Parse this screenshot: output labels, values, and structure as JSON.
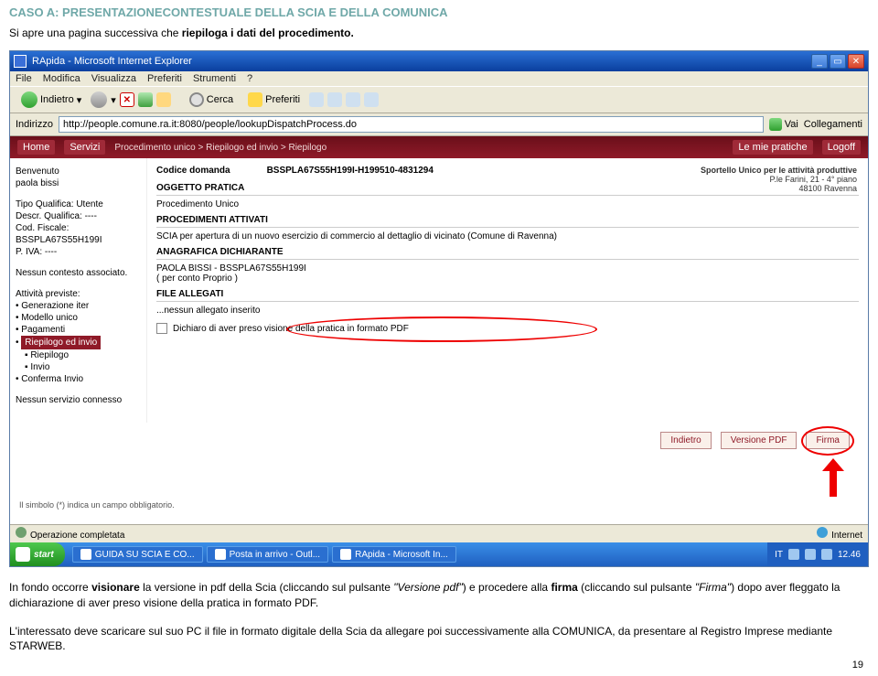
{
  "doc": {
    "title_line1": "CASO A: PRESENTAZIONECONTESTUALE  DELLA SCIA E DELLA COMUNICA",
    "intro_prefix": "Si apre una pagina successiva che ",
    "intro_bold": "riepiloga i dati del procedimento.",
    "page_num": "19"
  },
  "browser": {
    "title": "RApida - Microsoft Internet Explorer",
    "menu": {
      "file": "File",
      "modifica": "Modifica",
      "visualizza": "Visualizza",
      "preferiti": "Preferiti",
      "strumenti": "Strumenti",
      "help": "?"
    },
    "toolbar": {
      "indietro": "Indietro",
      "cerca": "Cerca",
      "preferiti": "Preferiti"
    },
    "address": {
      "label": "Indirizzo",
      "url": "http://people.comune.ra.it:8080/people/lookupDispatchProcess.do",
      "go": "Vai",
      "links": "Collegamenti"
    },
    "status": {
      "left": "Operazione completata",
      "right": "Internet"
    }
  },
  "app": {
    "nav": {
      "home": "Home",
      "servizi": "Servizi",
      "breadcrumb": "Procedimento unico > Riepilogo ed invio > Riepilogo",
      "pratiche": "Le mie pratiche",
      "logoff": "Logoff"
    },
    "right_info": {
      "l1": "Sportello Unico per le attività produttive",
      "l2": "P.le Farini, 21 - 4° piano",
      "l3": "48100 Ravenna"
    },
    "sidebar": {
      "benvenuto": "Benvenuto",
      "user": "paola bissi",
      "tipo": "Tipo Qualifica: Utente",
      "descr": "Descr. Qualifica: ----",
      "cod": "Cod. Fiscale:",
      "codval": "BSSPLA67S55H199I",
      "piva": "P. IVA: ----",
      "contesto": "Nessun contesto associato.",
      "attivita": "Attività previste:",
      "gen": "Generazione iter",
      "modello": "Modello unico",
      "pag": "Pagamenti",
      "riep_sel": "Riepilogo ed invio",
      "riep": "Riepilogo",
      "invio": "Invio",
      "conferma": "Conferma Invio",
      "servizio": "Nessun servizio connesso"
    },
    "main": {
      "codice_lbl": "Codice domanda",
      "codice_val": "BSSPLA67S55H199I-H199510-4831294",
      "oggetto_head": "OGGETTO PRATICA",
      "oggetto_val": "Procedimento Unico",
      "proc_head": "PROCEDIMENTI ATTIVATI",
      "proc_val": "SCIA per apertura di un nuovo esercizio di commercio al dettaglio di vicinato (Comune di Ravenna)",
      "anag_head": "ANAGRAFICA DICHIARANTE",
      "anag_val1": "PAOLA BISSI - BSSPLA67S55H199I",
      "anag_val2": "( per conto Proprio )",
      "file_head": "FILE ALLEGATI",
      "file_val": "...nessun allegato inserito",
      "dichiaro": "Dichiaro di aver preso visione della pratica in formato PDF",
      "btn_indietro": "Indietro",
      "btn_versione": "Versione PDF",
      "btn_firma": "Firma",
      "note": "Il simbolo (*) indica un campo obbligatorio."
    }
  },
  "taskbar": {
    "start": "start",
    "t1": "GUIDA SU SCIA E CO...",
    "t2": "Posta in arrivo - Outl...",
    "t3": "RApida - Microsoft In...",
    "lang": "IT",
    "time": "12.46"
  },
  "body": {
    "p1_a": "In fondo occorre ",
    "p1_b": "visionare",
    "p1_c": " la versione in pdf della Scia (cliccando sul pulsante ",
    "p1_d": "\"Versione pdf\"",
    "p1_e": ") e procedere alla ",
    "p1_f": "firma",
    "p1_g": " (cliccando sul pulsante ",
    "p1_h": "\"Firma\"",
    "p1_i": ") dopo aver fleggato la dichiarazione di aver preso visione della pratica in formato PDF.",
    "p2": "L'interessato deve scaricare sul suo PC il file in formato digitale della Scia da allegare poi successivamente alla COMUNICA, da presentare al Registro Imprese mediante STARWEB."
  }
}
